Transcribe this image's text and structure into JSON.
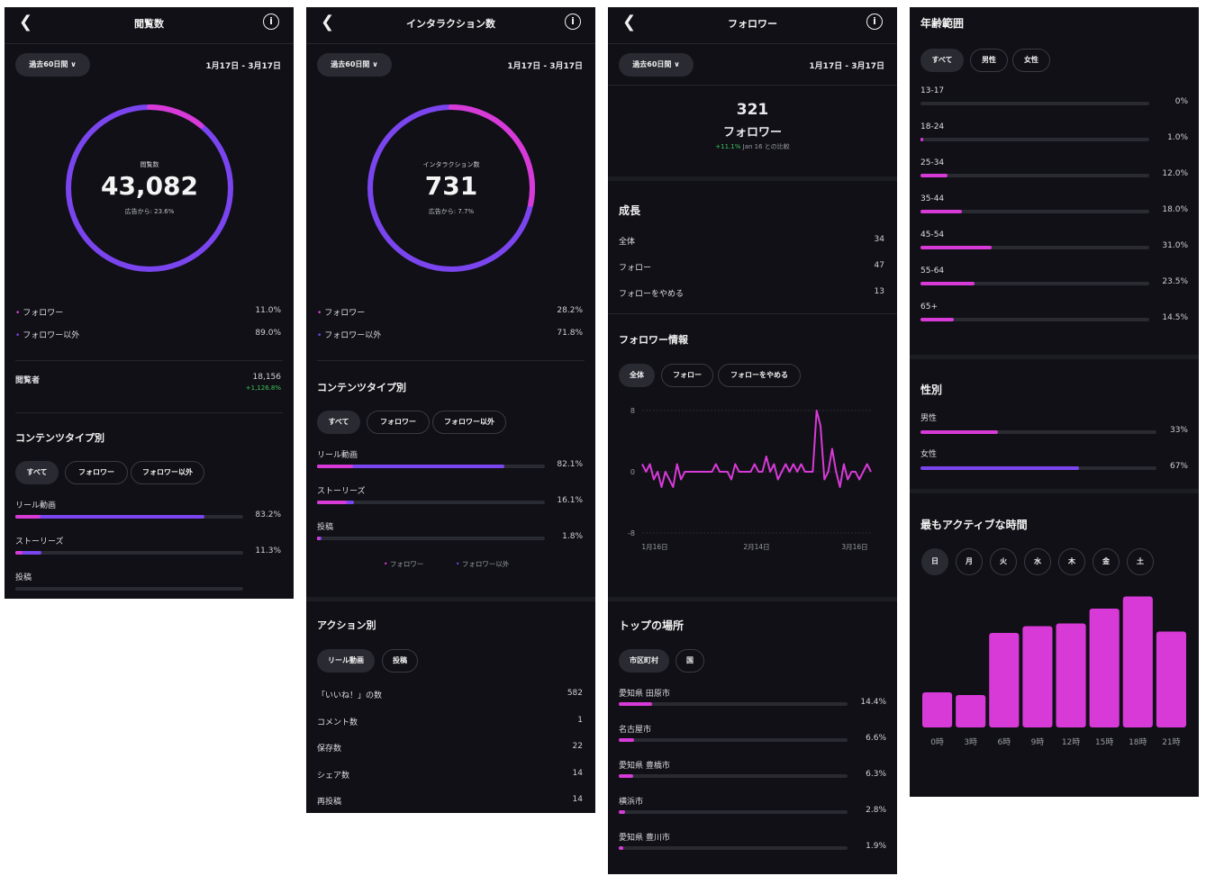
{
  "colors": {
    "accent_pink": "#d83ad8",
    "accent_purple": "#7a45ee",
    "bg": "#101016",
    "positive": "#3ec35a"
  },
  "common": {
    "period": "過去60日間",
    "date_range": "1月17日 - 3月17日",
    "back_icon": "chevron-left-icon",
    "info_icon": "info-icon"
  },
  "views": {
    "title": "閲覧数",
    "ring_label": "閲覧数",
    "total": "43,082",
    "ads_note": "広告から: 23.6%",
    "ring_follower_fraction": 0.11,
    "legend": [
      {
        "label": "フォロワー",
        "value": "11.0%"
      },
      {
        "label": "フォロワー以外",
        "value": "89.0%"
      }
    ],
    "viewers_label": "閲覧者",
    "viewers_value": "18,156",
    "viewers_change": "+1,126.8%",
    "content_type_title": "コンテンツタイプ別",
    "filters": [
      "すべて",
      "フォロワー",
      "フォロワー以外"
    ],
    "types": [
      {
        "label": "リール動画",
        "value": "83.2%",
        "total": 83.2,
        "follower": 11
      },
      {
        "label": "ストーリーズ",
        "value": "11.3%",
        "total": 11.3,
        "follower": 3
      },
      {
        "label": "投稿",
        "value": "",
        "total": 0,
        "follower": 0
      }
    ]
  },
  "interactions": {
    "title": "インタラクション数",
    "ring_label": "インタラクション数",
    "total": "731",
    "ads_note": "広告から: 7.7%",
    "ring_follower_fraction": 0.282,
    "legend": [
      {
        "label": "フォロワー",
        "value": "28.2%"
      },
      {
        "label": "フォロワー以外",
        "value": "71.8%"
      }
    ],
    "content_type_title": "コンテンツタイプ別",
    "filters": [
      "すべて",
      "フォロワー",
      "フォロワー以外"
    ],
    "types": [
      {
        "label": "リール動画",
        "value": "82.1%",
        "total": 82.1,
        "follower": 16
      },
      {
        "label": "ストーリーズ",
        "value": "16.1%",
        "total": 16.1,
        "follower": 13
      },
      {
        "label": "投稿",
        "value": "1.8%",
        "total": 1.8,
        "follower": 1
      }
    ],
    "bar_legend": [
      "フォロワー",
      "フォロワー以外"
    ],
    "action_title": "アクション別",
    "action_filters": [
      "リール動画",
      "投稿"
    ],
    "actions": [
      {
        "label": "「いいね！」の数",
        "value": "582"
      },
      {
        "label": "コメント数",
        "value": "1"
      },
      {
        "label": "保存数",
        "value": "22"
      },
      {
        "label": "シェア数",
        "value": "14"
      },
      {
        "label": "再投稿",
        "value": "14"
      }
    ]
  },
  "followers": {
    "title": "フォロワー",
    "count": "321",
    "count_label": "フォロワー",
    "change": "+11.1%",
    "change_note": "Jan 16 との比較",
    "growth_title": "成長",
    "growth": [
      {
        "label": "全体",
        "value": "34"
      },
      {
        "label": "フォロー",
        "value": "47"
      },
      {
        "label": "フォローをやめる",
        "value": "13"
      }
    ],
    "info_title": "フォロワー情報",
    "info_filters": [
      "全体",
      "フォロー",
      "フォローをやめる"
    ],
    "chart_data": {
      "type": "line",
      "y_ticks": [
        "8",
        "0",
        "-8"
      ],
      "x_ticks": [
        "1月16日",
        "2月14日",
        "3月16日"
      ],
      "ylim": [
        -8,
        8
      ],
      "values": [
        1,
        0,
        1,
        -1,
        0,
        -2,
        0,
        -1,
        -2,
        1,
        -1,
        0,
        0,
        0,
        0,
        0,
        0,
        0,
        0,
        1,
        0,
        0,
        0,
        -1,
        1,
        0,
        0,
        0,
        0,
        1,
        0,
        0,
        2,
        0,
        1,
        -1,
        0,
        1,
        0,
        1,
        0,
        1,
        0,
        0,
        0,
        8,
        6,
        -1,
        0,
        3,
        0,
        -2,
        1,
        -1,
        0,
        0,
        -1,
        0,
        1,
        0
      ]
    },
    "locations_title": "トップの場所",
    "location_filters": [
      "市区町村",
      "国"
    ],
    "locations": [
      {
        "label": "愛知県 田原市",
        "value": "14.4%",
        "pct": 14.4
      },
      {
        "label": "名古屋市",
        "value": "6.6%",
        "pct": 6.6
      },
      {
        "label": "愛知県 豊橋市",
        "value": "6.3%",
        "pct": 6.3
      },
      {
        "label": "横浜市",
        "value": "2.8%",
        "pct": 2.8
      },
      {
        "label": "愛知県 豊川市",
        "value": "1.9%",
        "pct": 1.9
      }
    ]
  },
  "demographics": {
    "age_title": "年齢範囲",
    "age_filters": [
      "すべて",
      "男性",
      "女性"
    ],
    "ages": [
      {
        "label": "13-17",
        "value": "0%",
        "pct": 0
      },
      {
        "label": "18-24",
        "value": "1.0%",
        "pct": 1.0
      },
      {
        "label": "25-34",
        "value": "12.0%",
        "pct": 12.0
      },
      {
        "label": "35-44",
        "value": "18.0%",
        "pct": 18.0
      },
      {
        "label": "45-54",
        "value": "31.0%",
        "pct": 31.0
      },
      {
        "label": "55-64",
        "value": "23.5%",
        "pct": 23.5
      },
      {
        "label": "65+",
        "value": "14.5%",
        "pct": 14.5
      }
    ],
    "gender_title": "性別",
    "genders": [
      {
        "label": "男性",
        "value": "33%",
        "pct": 33
      },
      {
        "label": "女性",
        "value": "67%",
        "pct": 67
      }
    ],
    "active_title": "最もアクティブな時間",
    "days": [
      "日",
      "月",
      "火",
      "水",
      "木",
      "金",
      "土"
    ],
    "chart_data": {
      "type": "bar",
      "categories": [
        "0時",
        "3時",
        "6時",
        "9時",
        "12時",
        "15時",
        "18時",
        "21時"
      ],
      "values": [
        26,
        24,
        70,
        75,
        77,
        88,
        97,
        71
      ],
      "ylim": [
        0,
        100
      ]
    }
  }
}
